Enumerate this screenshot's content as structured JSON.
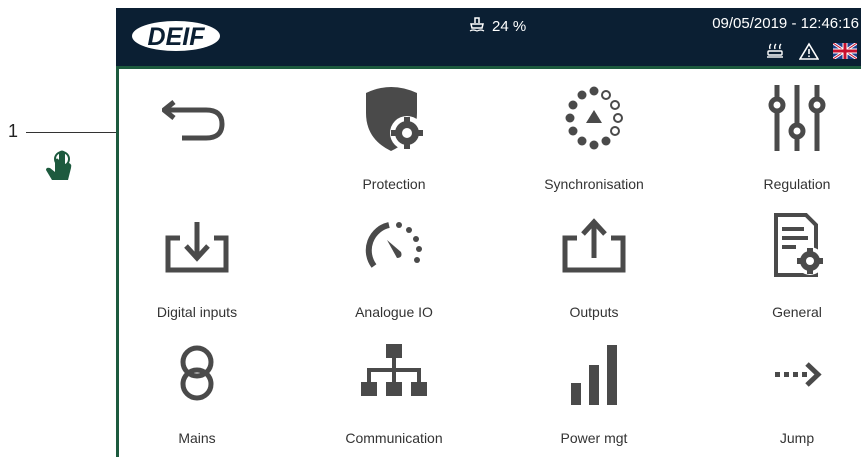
{
  "callout": {
    "number": "1"
  },
  "header": {
    "logo_text": "DEIF",
    "fuel_level": "24 %",
    "datetime": "09/05/2019 - 12:46:16",
    "status_icons": [
      "heater-icon",
      "warning-icon",
      "uk-flag-icon"
    ]
  },
  "menu": {
    "items": [
      {
        "label": "",
        "icon": "back-arrow-icon"
      },
      {
        "label": "Protection",
        "icon": "shield-gear-icon"
      },
      {
        "label": "Synchronisation",
        "icon": "sync-dots-icon"
      },
      {
        "label": "Regulation",
        "icon": "sliders-icon"
      },
      {
        "label": "Digital inputs",
        "icon": "input-arrow-icon"
      },
      {
        "label": "Analogue IO",
        "icon": "gauge-icon"
      },
      {
        "label": "Outputs",
        "icon": "output-arrow-icon"
      },
      {
        "label": "General",
        "icon": "document-gear-icon"
      },
      {
        "label": "Mains",
        "icon": "mains-rings-icon"
      },
      {
        "label": "Communication",
        "icon": "network-icon"
      },
      {
        "label": "Power mgt",
        "icon": "bar-chart-icon"
      },
      {
        "label": "Jump",
        "icon": "jump-arrow-icon"
      }
    ]
  },
  "colors": {
    "header_bg": "#0b1f33",
    "accent_green": "#1d5a3e",
    "icon_gray": "#4a4a4a"
  }
}
